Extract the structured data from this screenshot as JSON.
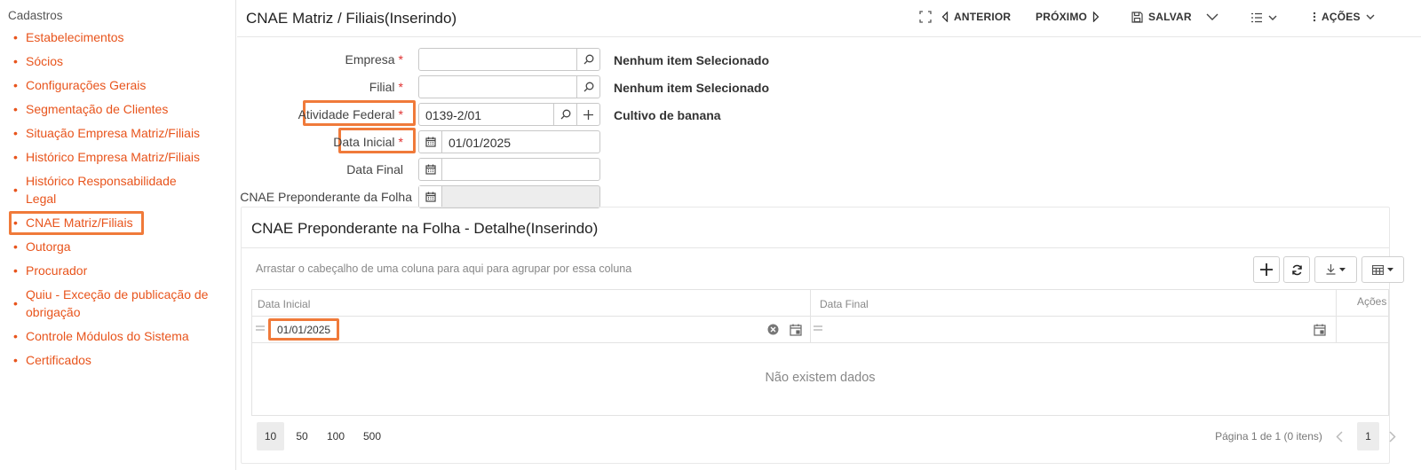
{
  "sidebar": {
    "title": "Cadastros",
    "items": [
      {
        "label": "Estabelecimentos"
      },
      {
        "label": "Sócios"
      },
      {
        "label": "Configurações Gerais"
      },
      {
        "label": "Segmentação de Clientes"
      },
      {
        "label": "Situação Empresa Matriz/Filiais"
      },
      {
        "label": "Histórico Empresa Matriz/Filiais"
      },
      {
        "label": "Histórico Responsabilidade Legal"
      },
      {
        "label": "CNAE Matriz/Filiais"
      },
      {
        "label": "Outorga"
      },
      {
        "label": "Procurador"
      },
      {
        "label": "Quiu - Exceção de publicação de obrigação"
      },
      {
        "label": "Controle Módulos do Sistema"
      },
      {
        "label": "Certificados"
      }
    ],
    "bullet": "•"
  },
  "header": {
    "title": "CNAE Matriz / Filiais(Inserindo)",
    "prev_label": "ANTERIOR",
    "next_label": "PRÓXIMO",
    "save_label": "SALVAR",
    "actions_label": "AÇÕES"
  },
  "form": {
    "required_mark": "*",
    "empresa": {
      "label": "Empresa",
      "value": "",
      "desc": "Nenhum item Selecionado"
    },
    "filial": {
      "label": "Filial",
      "value": "",
      "desc": "Nenhum item Selecionado"
    },
    "atividade": {
      "label": "Atividade Federal",
      "value": "0139-2/01",
      "desc": "Cultivo de banana"
    },
    "data_inicial": {
      "label": "Data Inicial",
      "value": "01/01/2025"
    },
    "data_final": {
      "label": "Data Final",
      "value": ""
    },
    "cnae_folha": {
      "label": "CNAE Preponderante da Folha",
      "value": ""
    }
  },
  "detail": {
    "title": "CNAE Preponderante na Folha - Detalhe(Inserindo)",
    "group_hint": "Arrastar o cabeçalho de uma coluna para aqui para agrupar por essa coluna",
    "columns": {
      "data_inicial": "Data Inicial",
      "data_final": "Data Final",
      "acoes": "Ações"
    },
    "filter": {
      "data_inicial": "01/01/2025",
      "data_final": ""
    },
    "no_data": "Não existem dados",
    "page_sizes": [
      "10",
      "50",
      "100",
      "500"
    ],
    "page_info": "Página 1 de 1 (0 itens)",
    "current_page": "1"
  },
  "colors": {
    "accent": "#e8541c",
    "highlight": "#f07a3a",
    "required": "#e03030"
  }
}
